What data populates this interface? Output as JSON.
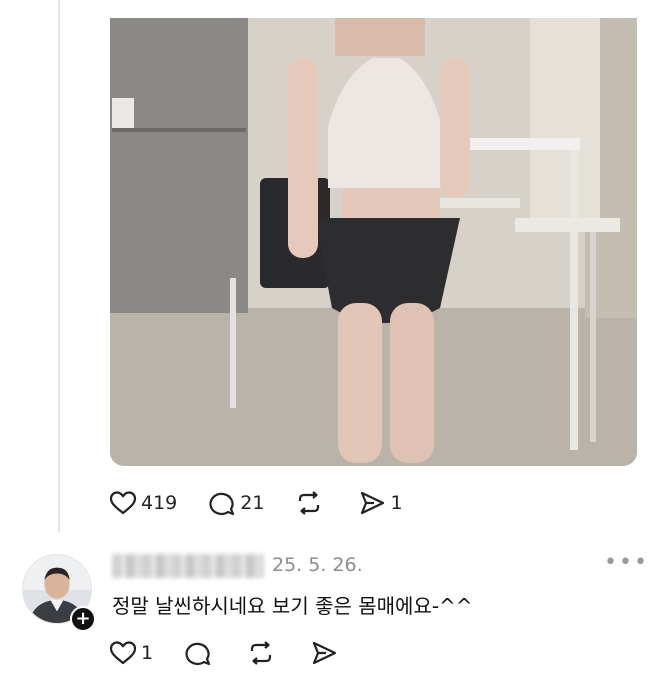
{
  "post": {
    "photo_alt": "",
    "actions": {
      "like_count": "419",
      "comment_count": "21",
      "repost_count": "",
      "share_count": "1"
    }
  },
  "reply": {
    "username": "",
    "timestamp": "25. 5. 26.",
    "more_label": "•••",
    "text": "정말 날씬하시네요 보기 좋은 몸매에요-^^",
    "follow_badge": "+",
    "actions": {
      "like_count": "1",
      "comment_count": "",
      "repost_count": "",
      "share_count": ""
    }
  },
  "icons": {
    "like": "heart-icon",
    "comment": "comment-icon",
    "repost": "repost-icon",
    "share": "share-icon",
    "more": "more-icon"
  }
}
